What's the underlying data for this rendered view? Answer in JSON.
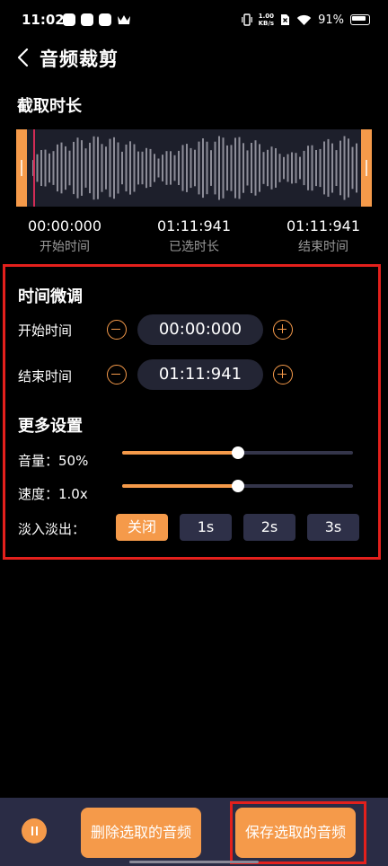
{
  "status_bar": {
    "time": "11:02",
    "net_speed_value": "1.00",
    "net_speed_unit": "KB/s",
    "battery": "91%"
  },
  "header": {
    "title": "音频裁剪"
  },
  "trim": {
    "section_title": "截取时长",
    "start_time": "00:00:000",
    "start_label": "开始时间",
    "selected_duration": "01:11:941",
    "selected_label": "已选时长",
    "end_time": "01:11:941",
    "end_label": "结束时间"
  },
  "fine_tune": {
    "section_title": "时间微调",
    "start_label": "开始时间",
    "start_value": "00:00:000",
    "end_label": "结束时间",
    "end_value": "01:11:941"
  },
  "more_settings": {
    "section_title": "更多设置",
    "volume_label": "音量：50%",
    "volume_level": 0.5,
    "speed_label": "速度：1.0x",
    "speed_level": 0.5,
    "fade_label": "淡入淡出：",
    "fade_options": [
      "关闭",
      "1s",
      "2s",
      "3s"
    ],
    "fade_selected": "关闭"
  },
  "bottom": {
    "delete_label": "删除选取的音频",
    "save_label": "保存选取的音频"
  },
  "colors": {
    "accent": "#f59a4a",
    "highlight": "#e3201c",
    "panel": "#232534",
    "bottom_bar": "#2a2c45"
  }
}
